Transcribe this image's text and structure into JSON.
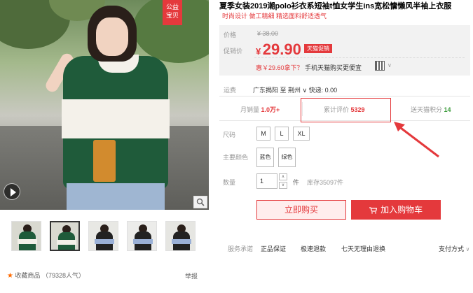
{
  "gallery": {
    "badge_line1": "公益",
    "badge_line2": "宝贝",
    "thumb_count": 5,
    "active_thumb": 1,
    "favorite_label": "收藏商品",
    "popularity": "（79328人气）",
    "report_label": "举报"
  },
  "product": {
    "title": "夏季女装2019潮polo衫衣系短袖t恤女学生ins宽松慵懒风半袖上衣服",
    "subtitle": "时尚设计 做工精细 精选面料舒适透气"
  },
  "price": {
    "original_label": "价格",
    "original_price": "¥ 38.00",
    "promo_label": "促销价",
    "currency": "¥",
    "promo_price": "29.90",
    "promo_tag": "天猫促销",
    "mobile_highlight": "惠￥29.60拿下？",
    "mobile_rest": "手机天猫购买更便宜"
  },
  "shipping": {
    "label": "运费",
    "value": "广东揭阳 至 荆州 ∨ 快递: 0.00"
  },
  "stats": {
    "monthly_label": "月销量",
    "monthly_value": "1.0万+",
    "reviews_label": "累计评价",
    "reviews_value": "5329",
    "points_label": "送天猫积分",
    "points_value": "14"
  },
  "sku": {
    "size_label": "尺码",
    "sizes": [
      "M",
      "L",
      "XL"
    ],
    "color_label": "主要颜色",
    "colors": [
      "蓝色",
      "绿色"
    ],
    "qty_label": "数量",
    "qty_value": "1",
    "qty_up": "∧",
    "qty_down": "∨",
    "qty_unit": "件",
    "stock": "库存35097件"
  },
  "actions": {
    "buy_now": "立即购买",
    "add_to_cart": "加入购物车"
  },
  "service": {
    "label": "服务承诺",
    "items": [
      "正品保证",
      "极速退款",
      "七天无理由退换"
    ],
    "payment": "支付方式"
  },
  "colors": {
    "brand_red": "#e4393c",
    "price_bg": "#f2f2f2",
    "points_green": "#3a9b3a"
  }
}
